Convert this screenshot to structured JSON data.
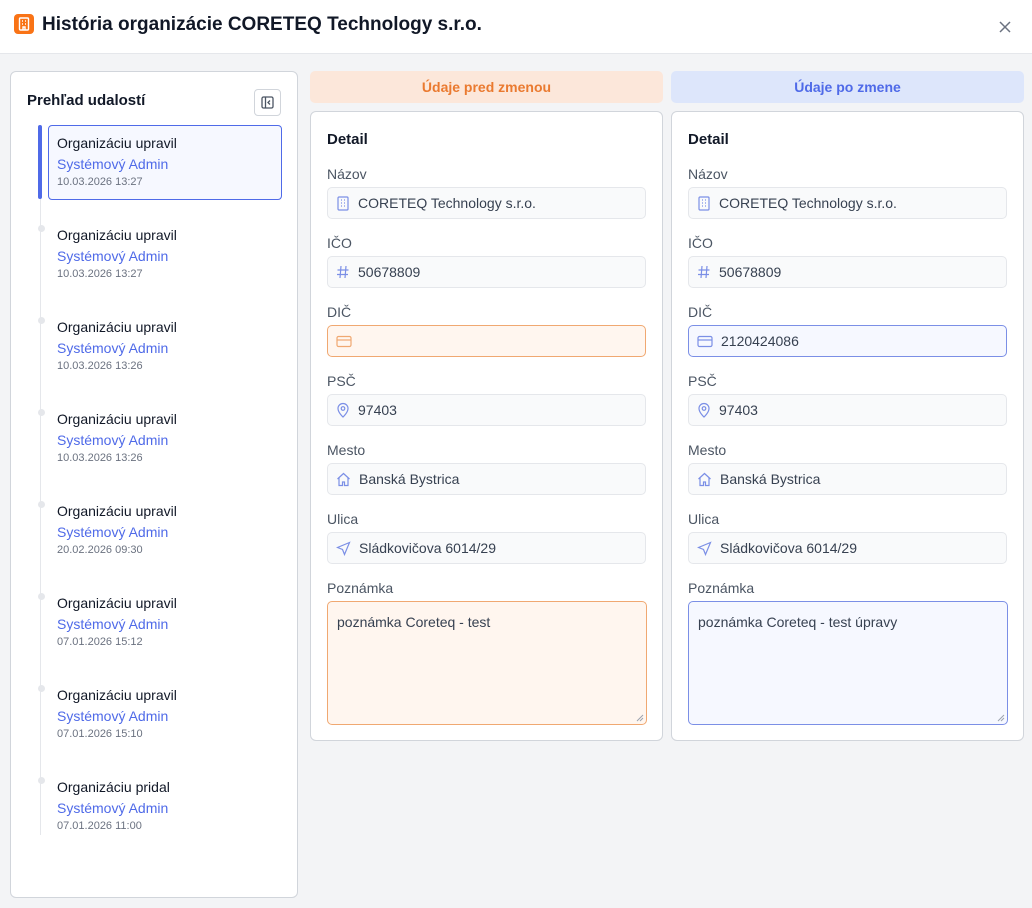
{
  "dialog": {
    "title": "História organizácie CORETEQ Technology s.r.o."
  },
  "sidebar": {
    "title": "Prehľad udalostí",
    "events": [
      {
        "action": "Organizáciu upravil",
        "user": "Systémový Admin",
        "time": "10.03.2026 13:27"
      },
      {
        "action": "Organizáciu upravil",
        "user": "Systémový Admin",
        "time": "10.03.2026 13:27"
      },
      {
        "action": "Organizáciu upravil",
        "user": "Systémový Admin",
        "time": "10.03.2026 13:26"
      },
      {
        "action": "Organizáciu upravil",
        "user": "Systémový Admin",
        "time": "10.03.2026 13:26"
      },
      {
        "action": "Organizáciu upravil",
        "user": "Systémový Admin",
        "time": "20.02.2026 09:30"
      },
      {
        "action": "Organizáciu upravil",
        "user": "Systémový Admin",
        "time": "07.01.2026 15:12"
      },
      {
        "action": "Organizáciu upravil",
        "user": "Systémový Admin",
        "time": "07.01.2026 15:10"
      },
      {
        "action": "Organizáciu pridal",
        "user": "Systémový Admin",
        "time": "07.01.2026 11:00"
      }
    ]
  },
  "before": {
    "header": "Údaje pred zmenou",
    "detail_title": "Detail",
    "fields": {
      "nazov": {
        "label": "Názov",
        "value": "CORETEQ Technology s.r.o."
      },
      "ico": {
        "label": "IČO",
        "value": "50678809"
      },
      "dic": {
        "label": "DIČ",
        "value": ""
      },
      "psc": {
        "label": "PSČ",
        "value": "97403"
      },
      "mesto": {
        "label": "Mesto",
        "value": "Banská Bystrica"
      },
      "ulica": {
        "label": "Ulica",
        "value": "Sládkovičova 6014/29"
      },
      "poznamka": {
        "label": "Poznámka",
        "value": "poznámka Coreteq - test"
      }
    }
  },
  "after": {
    "header": "Údaje po zmene",
    "detail_title": "Detail",
    "fields": {
      "nazov": {
        "label": "Názov",
        "value": "CORETEQ Technology s.r.o."
      },
      "ico": {
        "label": "IČO",
        "value": "50678809"
      },
      "dic": {
        "label": "DIČ",
        "value": "2120424086"
      },
      "psc": {
        "label": "PSČ",
        "value": "97403"
      },
      "mesto": {
        "label": "Mesto",
        "value": "Banská Bystrica"
      },
      "ulica": {
        "label": "Ulica",
        "value": "Sládkovičova 6014/29"
      },
      "poznamka": {
        "label": "Poznámka",
        "value": "poznámka Coreteq - test úpravy"
      }
    }
  },
  "colors": {
    "accent": "#4f6ae8",
    "changed_before": "#f0a871",
    "changed_after": "#7b8fe6",
    "brand_icon": "#f97316"
  },
  "icons": {
    "header": "building-icon",
    "close": "close-icon",
    "collapse": "sidebar-collapse-icon",
    "nazov": "building-icon",
    "ico": "hash-icon",
    "dic": "credit-card-icon",
    "psc": "map-pin-icon",
    "mesto": "home-icon",
    "ulica": "navigation-icon"
  }
}
